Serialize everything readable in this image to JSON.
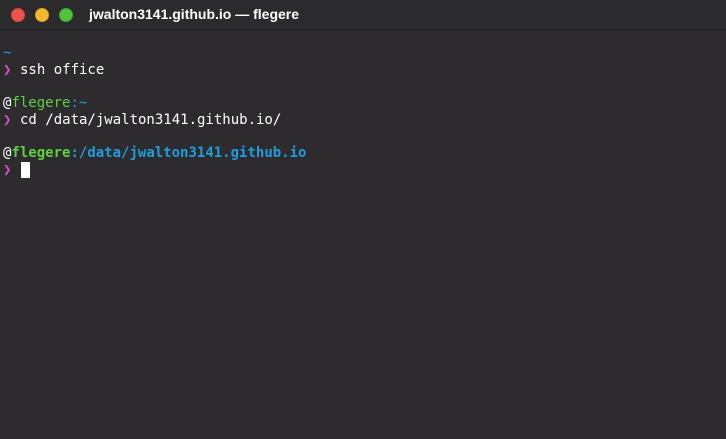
{
  "window": {
    "title": "jwalton3141.github.io — flegere"
  },
  "colors": {
    "background": "#2d2b2e",
    "prompt_arrow": "#d94fc9",
    "host": "#5ed141",
    "path": "#1e9ddf",
    "close": "#f0534c",
    "minimize": "#f5b830",
    "maximize": "#52c33d"
  },
  "terminal": {
    "block1": {
      "cwd": "~",
      "arrow": "❯",
      "command": "ssh office"
    },
    "block2": {
      "at": "@",
      "host": "flegere",
      "sep": ":",
      "cwd": "~",
      "arrow": "❯",
      "command": "cd /data/jwalton3141.github.io/"
    },
    "block3": {
      "at": "@",
      "host": "flegere",
      "sep": ":",
      "cwd": "/data/jwalton3141.github.io",
      "arrow": "❯",
      "command": ""
    }
  }
}
